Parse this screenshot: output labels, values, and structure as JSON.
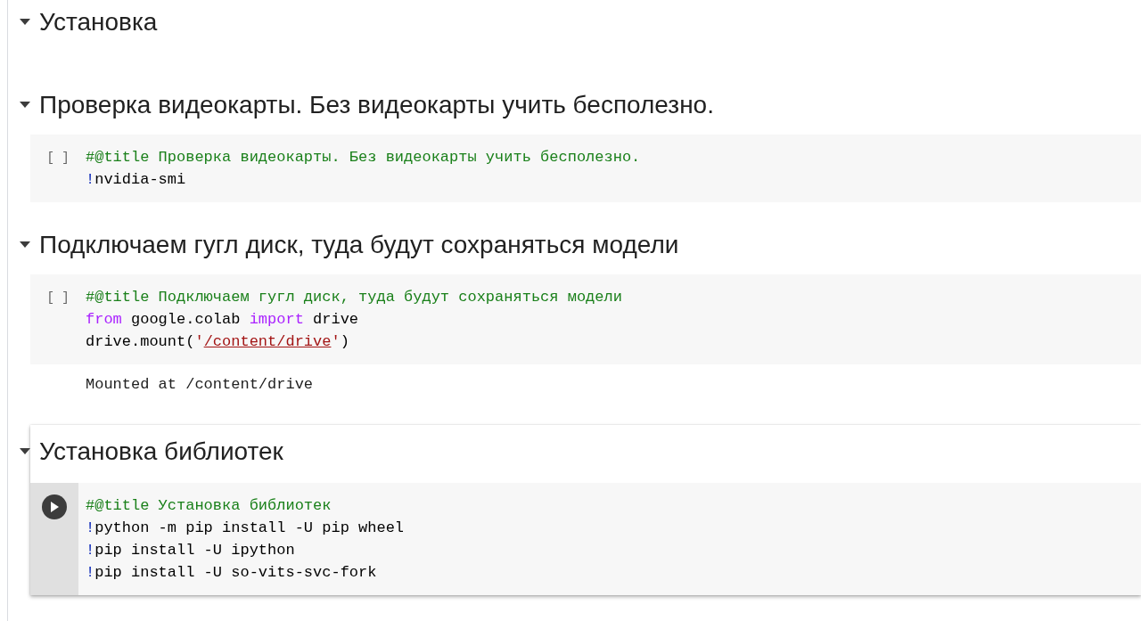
{
  "sections": [
    {
      "heading": "Установка",
      "expanded": true,
      "selected": false
    },
    {
      "heading": "Проверка видеокарты. Без видеокарты учить бесполезно.",
      "expanded": true,
      "selected": false,
      "cells": [
        {
          "kind": "idle",
          "indicator": "[ ]",
          "lines": [
            [
              {
                "kind": "comment",
                "text": "#@title Проверка видеокарты. Без видеокарты учить бесполезно."
              }
            ],
            [
              {
                "kind": "bang",
                "text": "!"
              },
              {
                "kind": "plain",
                "text": "nvidia-smi"
              }
            ]
          ]
        }
      ]
    },
    {
      "heading": "Подключаем гугл диск, туда будут сохраняться модели",
      "expanded": true,
      "selected": false,
      "cells": [
        {
          "kind": "idle",
          "indicator": "[ ]",
          "lines": [
            [
              {
                "kind": "comment",
                "text": "#@title Подключаем гугл диск, туда будут сохраняться модели"
              }
            ],
            [
              {
                "kind": "keyword",
                "text": "from"
              },
              {
                "kind": "plain",
                "text": " google.colab "
              },
              {
                "kind": "keyword",
                "text": "import"
              },
              {
                "kind": "plain",
                "text": " drive"
              }
            ],
            [
              {
                "kind": "plain",
                "text": "drive.mount("
              },
              {
                "kind": "string",
                "text": "'"
              },
              {
                "kind": "link",
                "text": "/content/drive"
              },
              {
                "kind": "string",
                "text": "'"
              },
              {
                "kind": "plain",
                "text": ")"
              }
            ]
          ],
          "output": [
            "Mounted at /content/drive"
          ]
        }
      ]
    },
    {
      "heading": "Установка библиотек",
      "expanded": true,
      "selected": true,
      "cells": [
        {
          "kind": "play",
          "lines": [
            [
              {
                "kind": "comment",
                "text": "#@title Установка библиотек"
              }
            ],
            [
              {
                "kind": "bang",
                "text": "!"
              },
              {
                "kind": "plain",
                "text": "python -m pip install -U pip wheel"
              }
            ],
            [
              {
                "kind": "bang",
                "text": "!"
              },
              {
                "kind": "plain",
                "text": "pip install -U ipython"
              }
            ],
            [
              {
                "kind": "bang",
                "text": "!"
              },
              {
                "kind": "plain",
                "text": "pip install -U so-vits-svc-fork"
              }
            ]
          ]
        }
      ]
    }
  ]
}
